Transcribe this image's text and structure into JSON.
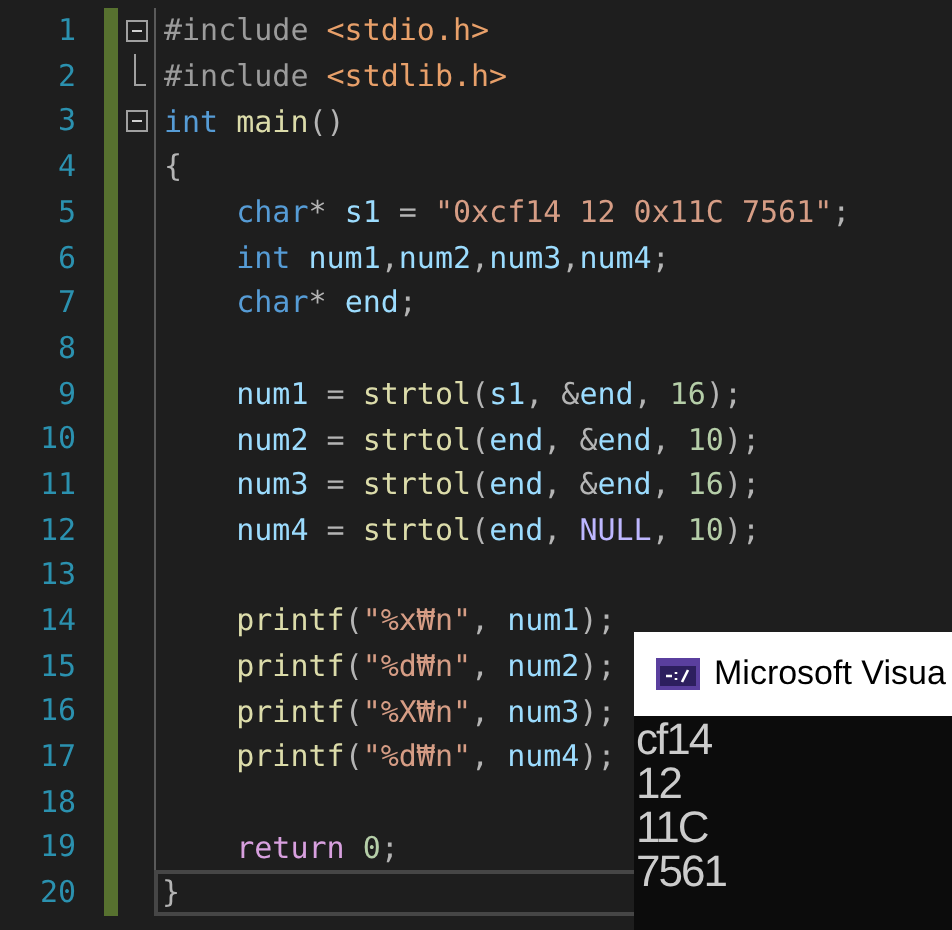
{
  "editor": {
    "lines": [
      {
        "number": "1",
        "kind": "foldstart",
        "current": false,
        "tokens": [
          {
            "kind": "preproc",
            "text": "#include "
          },
          {
            "kind": "include",
            "text": "<stdio.h>"
          }
        ]
      },
      {
        "number": "2",
        "kind": "foldend",
        "current": false,
        "tokens": [
          {
            "kind": "preproc",
            "text": "#include "
          },
          {
            "kind": "include",
            "text": "<stdlib.h>"
          }
        ]
      },
      {
        "number": "3",
        "kind": "foldstart",
        "current": false,
        "tokens": [
          {
            "kind": "keyword",
            "text": "int "
          },
          {
            "kind": "function",
            "text": "main"
          },
          {
            "kind": "punct",
            "text": "()"
          }
        ]
      },
      {
        "number": "4",
        "kind": "plain",
        "current": false,
        "tokens": [
          {
            "kind": "punct",
            "text": "{"
          }
        ]
      },
      {
        "number": "5",
        "kind": "plain",
        "current": false,
        "tokens": [
          {
            "kind": "keyword",
            "text": "    char"
          },
          {
            "kind": "punct",
            "text": "* "
          },
          {
            "kind": "variable",
            "text": "s1"
          },
          {
            "kind": "punct",
            "text": " = "
          },
          {
            "kind": "string",
            "text": "\"0xcf14 12 0x11C 7561\""
          },
          {
            "kind": "punct",
            "text": ";"
          }
        ]
      },
      {
        "number": "6",
        "kind": "plain",
        "current": false,
        "tokens": [
          {
            "kind": "keyword",
            "text": "    int "
          },
          {
            "kind": "variable",
            "text": "num1"
          },
          {
            "kind": "punct",
            "text": ","
          },
          {
            "kind": "variable",
            "text": "num2"
          },
          {
            "kind": "punct",
            "text": ","
          },
          {
            "kind": "variable",
            "text": "num3"
          },
          {
            "kind": "punct",
            "text": ","
          },
          {
            "kind": "variable",
            "text": "num4"
          },
          {
            "kind": "punct",
            "text": ";"
          }
        ]
      },
      {
        "number": "7",
        "kind": "plain",
        "current": false,
        "tokens": [
          {
            "kind": "keyword",
            "text": "    char"
          },
          {
            "kind": "punct",
            "text": "* "
          },
          {
            "kind": "variable",
            "text": "end"
          },
          {
            "kind": "punct",
            "text": ";"
          }
        ]
      },
      {
        "number": "8",
        "kind": "plain",
        "current": false
      },
      {
        "number": "9",
        "kind": "plain",
        "current": false,
        "tokens": [
          {
            "kind": "variable",
            "text": "    num1"
          },
          {
            "kind": "punct",
            "text": " = "
          },
          {
            "kind": "function",
            "text": "strtol"
          },
          {
            "kind": "punct",
            "text": "("
          },
          {
            "kind": "variable",
            "text": "s1"
          },
          {
            "kind": "punct",
            "text": ", &"
          },
          {
            "kind": "variable",
            "text": "end"
          },
          {
            "kind": "punct",
            "text": ", "
          },
          {
            "kind": "number",
            "text": "16"
          },
          {
            "kind": "punct",
            "text": ");"
          }
        ]
      },
      {
        "number": "10",
        "kind": "plain",
        "current": false,
        "tokens": [
          {
            "kind": "variable",
            "text": "    num2"
          },
          {
            "kind": "punct",
            "text": " = "
          },
          {
            "kind": "function",
            "text": "strtol"
          },
          {
            "kind": "punct",
            "text": "("
          },
          {
            "kind": "variable",
            "text": "end"
          },
          {
            "kind": "punct",
            "text": ", &"
          },
          {
            "kind": "variable",
            "text": "end"
          },
          {
            "kind": "punct",
            "text": ", "
          },
          {
            "kind": "number",
            "text": "10"
          },
          {
            "kind": "punct",
            "text": ");"
          }
        ]
      },
      {
        "number": "11",
        "kind": "plain",
        "current": false,
        "tokens": [
          {
            "kind": "variable",
            "text": "    num3"
          },
          {
            "kind": "punct",
            "text": " = "
          },
          {
            "kind": "function",
            "text": "strtol"
          },
          {
            "kind": "punct",
            "text": "("
          },
          {
            "kind": "variable",
            "text": "end"
          },
          {
            "kind": "punct",
            "text": ", &"
          },
          {
            "kind": "variable",
            "text": "end"
          },
          {
            "kind": "punct",
            "text": ", "
          },
          {
            "kind": "number",
            "text": "16"
          },
          {
            "kind": "punct",
            "text": ");"
          }
        ]
      },
      {
        "number": "12",
        "kind": "plain",
        "current": false,
        "tokens": [
          {
            "kind": "variable",
            "text": "    num4"
          },
          {
            "kind": "punct",
            "text": " = "
          },
          {
            "kind": "function",
            "text": "strtol"
          },
          {
            "kind": "punct",
            "text": "("
          },
          {
            "kind": "variable",
            "text": "end"
          },
          {
            "kind": "punct",
            "text": ", "
          },
          {
            "kind": "macro",
            "text": "NULL"
          },
          {
            "kind": "punct",
            "text": ", "
          },
          {
            "kind": "number",
            "text": "10"
          },
          {
            "kind": "punct",
            "text": ");"
          }
        ]
      },
      {
        "number": "13",
        "kind": "plain",
        "current": false
      },
      {
        "number": "14",
        "kind": "plain",
        "current": false,
        "tokens": [
          {
            "kind": "function",
            "text": "    printf"
          },
          {
            "kind": "punct",
            "text": "("
          },
          {
            "kind": "string",
            "text": "\"%x₩n\""
          },
          {
            "kind": "punct",
            "text": ", "
          },
          {
            "kind": "variable",
            "text": "num1"
          },
          {
            "kind": "punct",
            "text": ");"
          }
        ]
      },
      {
        "number": "15",
        "kind": "plain",
        "current": false,
        "tokens": [
          {
            "kind": "function",
            "text": "    printf"
          },
          {
            "kind": "punct",
            "text": "("
          },
          {
            "kind": "string",
            "text": "\"%d₩n\""
          },
          {
            "kind": "punct",
            "text": ", "
          },
          {
            "kind": "variable",
            "text": "num2"
          },
          {
            "kind": "punct",
            "text": ");"
          }
        ]
      },
      {
        "number": "16",
        "kind": "plain",
        "current": false,
        "tokens": [
          {
            "kind": "function",
            "text": "    printf"
          },
          {
            "kind": "punct",
            "text": "("
          },
          {
            "kind": "string",
            "text": "\"%X₩n\""
          },
          {
            "kind": "punct",
            "text": ", "
          },
          {
            "kind": "variable",
            "text": "num3"
          },
          {
            "kind": "punct",
            "text": ");"
          }
        ]
      },
      {
        "number": "17",
        "kind": "plain",
        "current": false,
        "tokens": [
          {
            "kind": "function",
            "text": "    printf"
          },
          {
            "kind": "punct",
            "text": "("
          },
          {
            "kind": "string",
            "text": "\"%d₩n\""
          },
          {
            "kind": "punct",
            "text": ", "
          },
          {
            "kind": "variable",
            "text": "num4"
          },
          {
            "kind": "punct",
            "text": ");"
          }
        ]
      },
      {
        "number": "18",
        "kind": "plain",
        "current": false
      },
      {
        "number": "19",
        "kind": "plain",
        "current": false,
        "tokens": [
          {
            "kind": "control",
            "text": "    return "
          },
          {
            "kind": "number",
            "text": "0"
          },
          {
            "kind": "punct",
            "text": ";"
          }
        ]
      },
      {
        "number": "20",
        "kind": "plain",
        "current": true,
        "tokens": [
          {
            "kind": "punct",
            "text": "}"
          }
        ]
      }
    ]
  },
  "console": {
    "title": "Microsoft Visua",
    "output": [
      "cf14",
      "12",
      "11C",
      "7561"
    ]
  }
}
